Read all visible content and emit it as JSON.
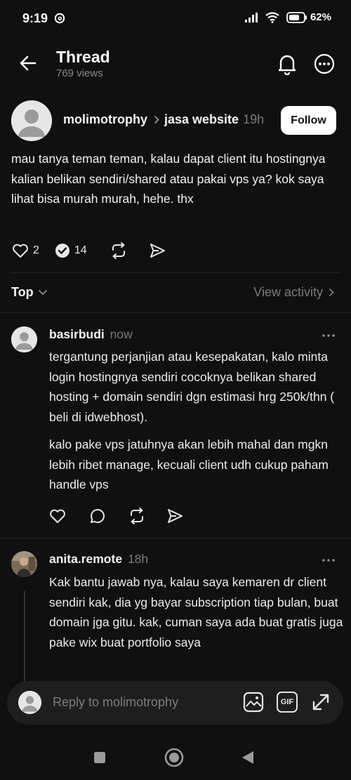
{
  "status": {
    "time": "9:19",
    "battery": "62%"
  },
  "header": {
    "title": "Thread",
    "views": "769 views"
  },
  "post": {
    "author": "molimotrophy",
    "community": "jasa website",
    "time": "19h",
    "follow_label": "Follow",
    "text": "mau tanya teman teman, kalau dapat client itu hostingnya kalian belikan sendiri/shared atau pakai vps ya? kok saya lihat bisa murah murah, hehe. thx",
    "likes": "2",
    "replies": "14"
  },
  "sort": {
    "label": "Top",
    "view_activity": "View activity"
  },
  "replies": [
    {
      "author": "basirbudi",
      "time": "now",
      "paragraph1": "tergantung perjanjian atau kesepakatan, kalo minta login hostingnya sendiri cocoknya belikan shared hosting + domain sendiri dgn estimasi  hrg 250k/thn ( beli di idwebhost).",
      "paragraph2": "kalo pake vps jatuhnya akan lebih mahal dan mgkn lebih ribet manage, kecuali client udh cukup paham handle vps"
    },
    {
      "author": "anita.remote",
      "time": "18h",
      "text": "Kak bantu jawab nya, kalau saya kemaren dr client sendiri kak, dia yg bayar subscription tiap bulan, buat domain jga gitu. kak, cuman saya ada buat gratis juga pake wix buat portfolio saya"
    }
  ],
  "composer": {
    "placeholder": "Reply to molimotrophy",
    "gif_label": "GIF"
  },
  "colors": {
    "background": "#101010",
    "accent_text": "#f3f3f3",
    "muted": "#7a7a7a"
  }
}
